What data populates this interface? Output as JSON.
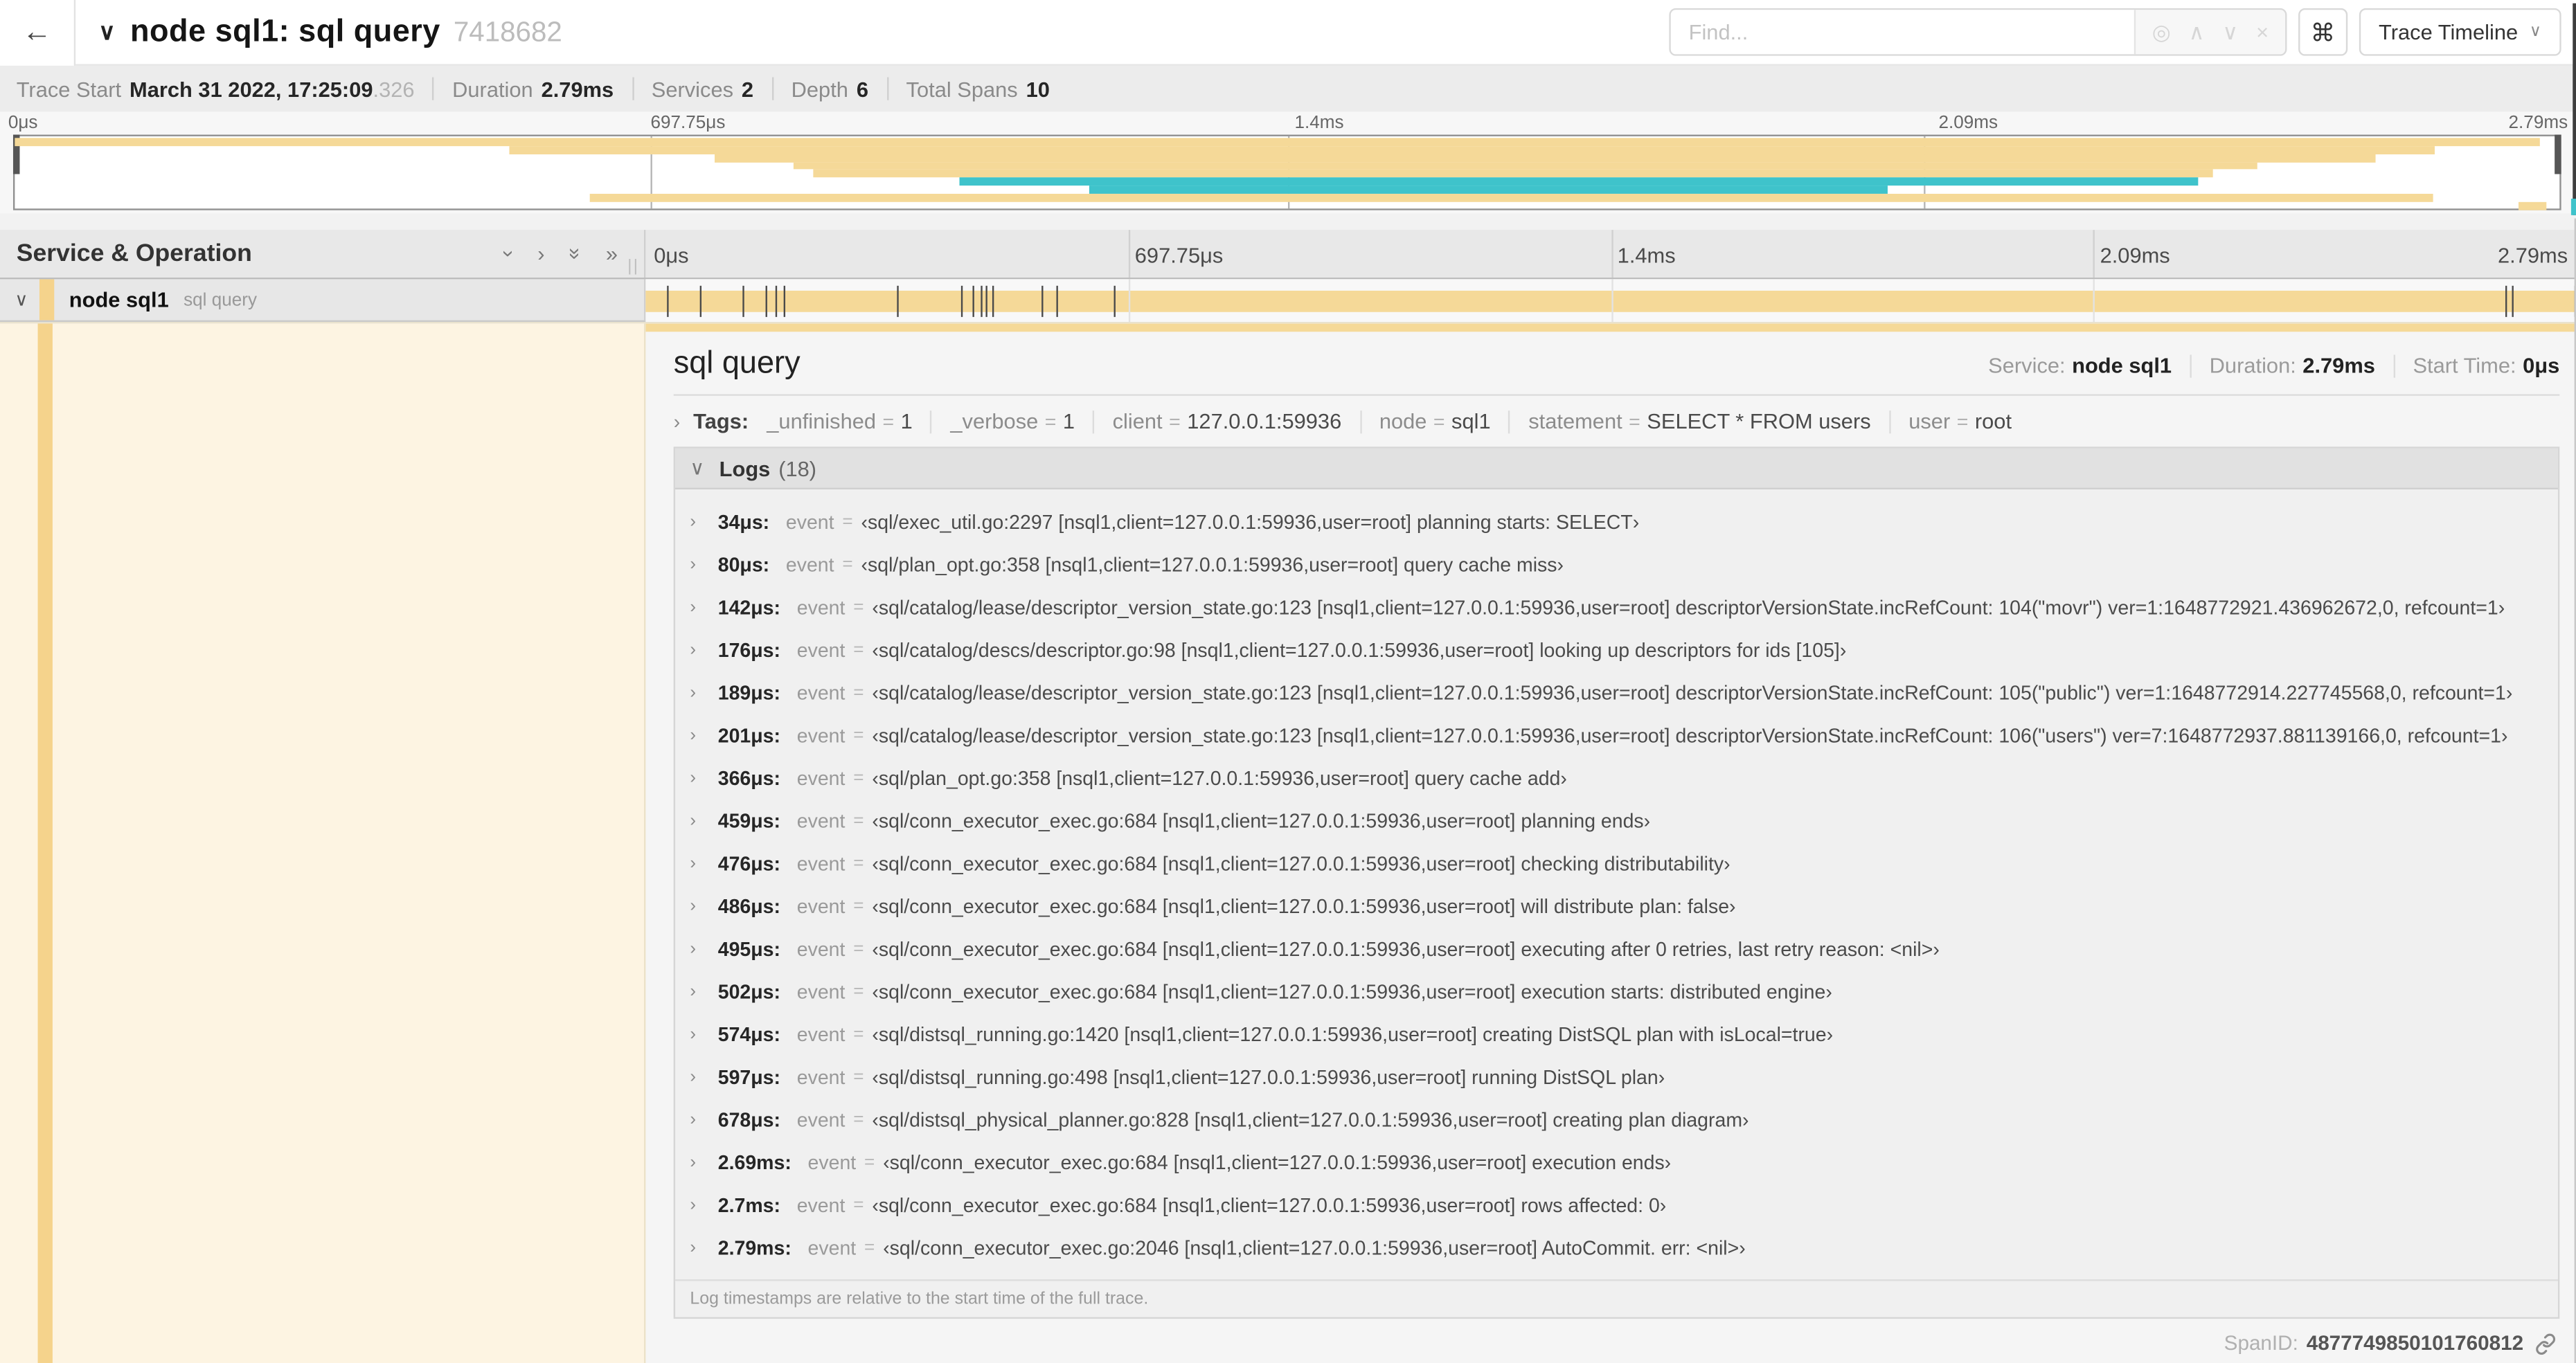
{
  "header": {
    "back_icon": "←",
    "title_chevron": "∨",
    "title": "node sql1: sql query",
    "trace_id_short": "7418682",
    "find_placeholder": "Find...",
    "shortcut_button": "⌘",
    "view_select": "Trace Timeline"
  },
  "trace_summary": {
    "trace_start_label": "Trace Start",
    "trace_start_value": "March 31 2022, 17:25:09",
    "trace_start_ms": ".326",
    "duration_label": "Duration",
    "duration_value": "2.79ms",
    "services_label": "Services",
    "services_value": "2",
    "depth_label": "Depth",
    "depth_value": "6",
    "total_spans_label": "Total Spans",
    "total_spans_value": "10"
  },
  "timeline": {
    "left_header": "Service & Operation",
    "ticks": [
      "0μs",
      "697.75μs",
      "1.4ms",
      "2.09ms",
      "2.79ms"
    ],
    "span_row": {
      "service": "node sql1",
      "operation": "sql query"
    }
  },
  "minimap": {
    "bars": [
      {
        "l": 0,
        "r": 99.2,
        "row": 0,
        "c": "beige"
      },
      {
        "l": 19.4,
        "r": 95.1,
        "row": 1,
        "c": "beige"
      },
      {
        "l": 27.5,
        "r": 92.8,
        "row": 2,
        "c": "beige"
      },
      {
        "l": 30.6,
        "r": 88.1,
        "row": 3,
        "c": "beige"
      },
      {
        "l": 31.4,
        "r": 86.4,
        "row": 4,
        "c": "beige"
      },
      {
        "l": 37.1,
        "r": 85.8,
        "row": 5,
        "c": "teal"
      },
      {
        "l": 42.2,
        "r": 73.6,
        "row": 6,
        "c": "teal"
      },
      {
        "l": 22.6,
        "r": 95.0,
        "row": 7,
        "c": "beige"
      },
      {
        "l": 98.4,
        "r": 99.5,
        "row": 8,
        "c": "beige"
      }
    ]
  },
  "detail": {
    "title": "sql query",
    "service_label": "Service:",
    "service": "node sql1",
    "duration_label": "Duration:",
    "duration": "2.79ms",
    "start_time_label": "Start Time:",
    "start_time": "0μs",
    "tags_label": "Tags:",
    "tags": [
      {
        "key": "_unfinished",
        "value": "1"
      },
      {
        "key": "_verbose",
        "value": "1"
      },
      {
        "key": "client",
        "value": "127.0.0.1:59936"
      },
      {
        "key": "node",
        "value": "sql1"
      },
      {
        "key": "statement",
        "value": "SELECT * FROM users"
      },
      {
        "key": "user",
        "value": "root"
      }
    ],
    "logs_label": "Logs",
    "logs_count": "(18)",
    "log_field_label": "event",
    "logs": [
      {
        "t": "34μs:",
        "frac": 0.0122,
        "msg": "‹sql/exec_util.go:2297 [nsql1,client=127.0.0.1:59936,user=root] planning starts: SELECT›"
      },
      {
        "t": "80μs:",
        "frac": 0.0287,
        "msg": "‹sql/plan_opt.go:358 [nsql1,client=127.0.0.1:59936,user=root] query cache miss›"
      },
      {
        "t": "142μs:",
        "frac": 0.0509,
        "msg": "‹sql/catalog/lease/descriptor_version_state.go:123 [nsql1,client=127.0.0.1:59936,user=root] descriptorVersionState.incRefCount: 104(\"movr\") ver=1:1648772921.436962672,0, refcount=1›"
      },
      {
        "t": "176μs:",
        "frac": 0.0631,
        "msg": "‹sql/catalog/descs/descriptor.go:98 [nsql1,client=127.0.0.1:59936,user=root] looking up descriptors for ids [105]›"
      },
      {
        "t": "189μs:",
        "frac": 0.0677,
        "msg": "‹sql/catalog/lease/descriptor_version_state.go:123 [nsql1,client=127.0.0.1:59936,user=root] descriptorVersionState.incRefCount: 105(\"public\") ver=1:1648772914.227745568,0, refcount=1›"
      },
      {
        "t": "201μs:",
        "frac": 0.072,
        "msg": "‹sql/catalog/lease/descriptor_version_state.go:123 [nsql1,client=127.0.0.1:59936,user=root] descriptorVersionState.incRefCount: 106(\"users\") ver=7:1648772937.881139166,0, refcount=1›"
      },
      {
        "t": "366μs:",
        "frac": 0.1312,
        "msg": "‹sql/plan_opt.go:358 [nsql1,client=127.0.0.1:59936,user=root] query cache add›"
      },
      {
        "t": "459μs:",
        "frac": 0.1645,
        "msg": "‹sql/conn_executor_exec.go:684 [nsql1,client=127.0.0.1:59936,user=root] planning ends›"
      },
      {
        "t": "476μs:",
        "frac": 0.1706,
        "msg": "‹sql/conn_executor_exec.go:684 [nsql1,client=127.0.0.1:59936,user=root] checking distributability›"
      },
      {
        "t": "486μs:",
        "frac": 0.1742,
        "msg": "‹sql/conn_executor_exec.go:684 [nsql1,client=127.0.0.1:59936,user=root] will distribute plan: false›"
      },
      {
        "t": "495μs:",
        "frac": 0.1774,
        "msg": "‹sql/conn_executor_exec.go:684 [nsql1,client=127.0.0.1:59936,user=root] executing after 0 retries, last retry reason: <nil>›"
      },
      {
        "t": "502μs:",
        "frac": 0.18,
        "msg": "‹sql/conn_executor_exec.go:684 [nsql1,client=127.0.0.1:59936,user=root] execution starts: distributed engine›"
      },
      {
        "t": "574μs:",
        "frac": 0.2057,
        "msg": "‹sql/distsql_running.go:1420 [nsql1,client=127.0.0.1:59936,user=root] creating DistSQL plan with isLocal=true›"
      },
      {
        "t": "597μs:",
        "frac": 0.214,
        "msg": "‹sql/distsql_running.go:498 [nsql1,client=127.0.0.1:59936,user=root] running DistSQL plan›"
      },
      {
        "t": "678μs:",
        "frac": 0.243,
        "msg": "‹sql/distsql_physical_planner.go:828 [nsql1,client=127.0.0.1:59936,user=root] creating plan diagram›"
      },
      {
        "t": "2.69ms:",
        "frac": 0.9642,
        "msg": "‹sql/conn_executor_exec.go:684 [nsql1,client=127.0.0.1:59936,user=root] execution ends›"
      },
      {
        "t": "2.7ms:",
        "frac": 0.9677,
        "msg": "‹sql/conn_executor_exec.go:684 [nsql1,client=127.0.0.1:59936,user=root] rows affected: 0›"
      },
      {
        "t": "2.79ms:",
        "frac": 1.0,
        "msg": "‹sql/conn_executor_exec.go:2046 [nsql1,client=127.0.0.1:59936,user=root] AutoCommit. err: <nil>›"
      }
    ],
    "logs_footnote": "Log timestamps are relative to the start time of the full trace.",
    "span_id_label": "SpanID:",
    "span_id": "4877749850101760812"
  },
  "colors": {
    "beige": "#f5d998",
    "teal": "#3fc3cb",
    "accent_stripe": "#f5d38c",
    "cream": "#fdf4e2"
  }
}
